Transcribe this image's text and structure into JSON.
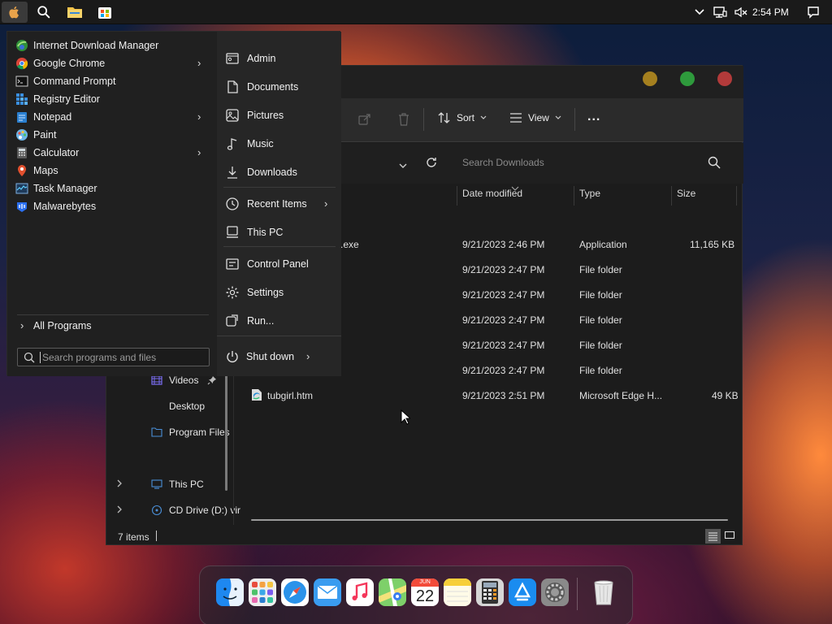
{
  "taskbar": {
    "clock": "2:54 PM",
    "icons": [
      "apple-menu-icon",
      "search-icon",
      "file-explorer-icon",
      "store-icon"
    ],
    "tray_icons": [
      "chevron-up-icon",
      "network-icon",
      "volume-muted-icon",
      "notifications-icon"
    ]
  },
  "start_menu": {
    "apps": [
      {
        "label": "Internet Download Manager",
        "icon": "idm-icon",
        "submenu": false
      },
      {
        "label": "Google Chrome",
        "icon": "chrome-icon",
        "submenu": true
      },
      {
        "label": "Command Prompt",
        "icon": "cmd-icon",
        "submenu": false
      },
      {
        "label": "Registry Editor",
        "icon": "regedit-icon",
        "submenu": false
      },
      {
        "label": "Notepad",
        "icon": "notepad-icon",
        "submenu": true
      },
      {
        "label": "Paint",
        "icon": "paint-icon",
        "submenu": false
      },
      {
        "label": "Calculator",
        "icon": "calculator-icon",
        "submenu": true
      },
      {
        "label": "Maps",
        "icon": "maps-icon",
        "submenu": false
      },
      {
        "label": "Task Manager",
        "icon": "task-manager-icon",
        "submenu": false
      },
      {
        "label": "Malwarebytes",
        "icon": "malwarebytes-icon",
        "submenu": false
      }
    ],
    "all_programs": "All Programs",
    "search_placeholder": "Search programs and files",
    "places": [
      {
        "label": "Admin",
        "icon": "user-folder-icon"
      },
      {
        "label": "Documents",
        "icon": "document-icon"
      },
      {
        "label": "Pictures",
        "icon": "picture-icon"
      },
      {
        "label": "Music",
        "icon": "music-icon"
      },
      {
        "label": "Downloads",
        "icon": "download-icon"
      },
      {
        "label": "Recent Items",
        "icon": "clock-icon",
        "submenu": true
      },
      {
        "label": "This PC",
        "icon": "computer-icon"
      },
      {
        "label": "Control Panel",
        "icon": "control-panel-icon"
      },
      {
        "label": "Settings",
        "icon": "gear-icon"
      },
      {
        "label": "Run...",
        "icon": "run-icon"
      }
    ],
    "shutdown": "Shut down"
  },
  "explorer": {
    "toolbar": {
      "sort": "Sort",
      "view": "View",
      "more": "..."
    },
    "search_placeholder": "Search Downloads",
    "columns": {
      "date": "Date modified",
      "type": "Type",
      "size": "Size"
    },
    "rows": [
      {
        "name": ".exe",
        "date": "9/21/2023 2:46 PM",
        "type": "Application",
        "size": "11,165 KB"
      },
      {
        "name": "",
        "date": "9/21/2023 2:47 PM",
        "type": "File folder",
        "size": ""
      },
      {
        "name": "",
        "date": "9/21/2023 2:47 PM",
        "type": "File folder",
        "size": ""
      },
      {
        "name": "",
        "date": "9/21/2023 2:47 PM",
        "type": "File folder",
        "size": ""
      },
      {
        "name": "",
        "date": "9/21/2023 2:47 PM",
        "type": "File folder",
        "size": ""
      },
      {
        "name": "",
        "date": "9/21/2023 2:47 PM",
        "type": "File folder",
        "size": ""
      },
      {
        "name": "tubgirl.htm",
        "date": "9/21/2023 2:51 PM",
        "type": "Microsoft Edge H...",
        "size": "49 KB"
      }
    ],
    "nav": {
      "videos": "Videos",
      "desktop": "Desktop",
      "program_files": "Program Files",
      "this_pc": "This PC",
      "cd_drive": "CD Drive (D:) vir"
    },
    "status": "7 items",
    "colors": {
      "close": "#b23a3a",
      "maximize": "#2e9a3c",
      "minimize": "#a5801f"
    }
  },
  "dock": {
    "calendar_month": "JUN",
    "calendar_day": "22",
    "icons": [
      "finder-icon",
      "launchpad-icon",
      "safari-icon",
      "mail-icon",
      "music-app-icon",
      "maps-app-icon",
      "calendar-icon",
      "notes-icon",
      "calculator-app-icon",
      "app-store-icon",
      "system-preferences-icon",
      "trash-icon"
    ]
  }
}
